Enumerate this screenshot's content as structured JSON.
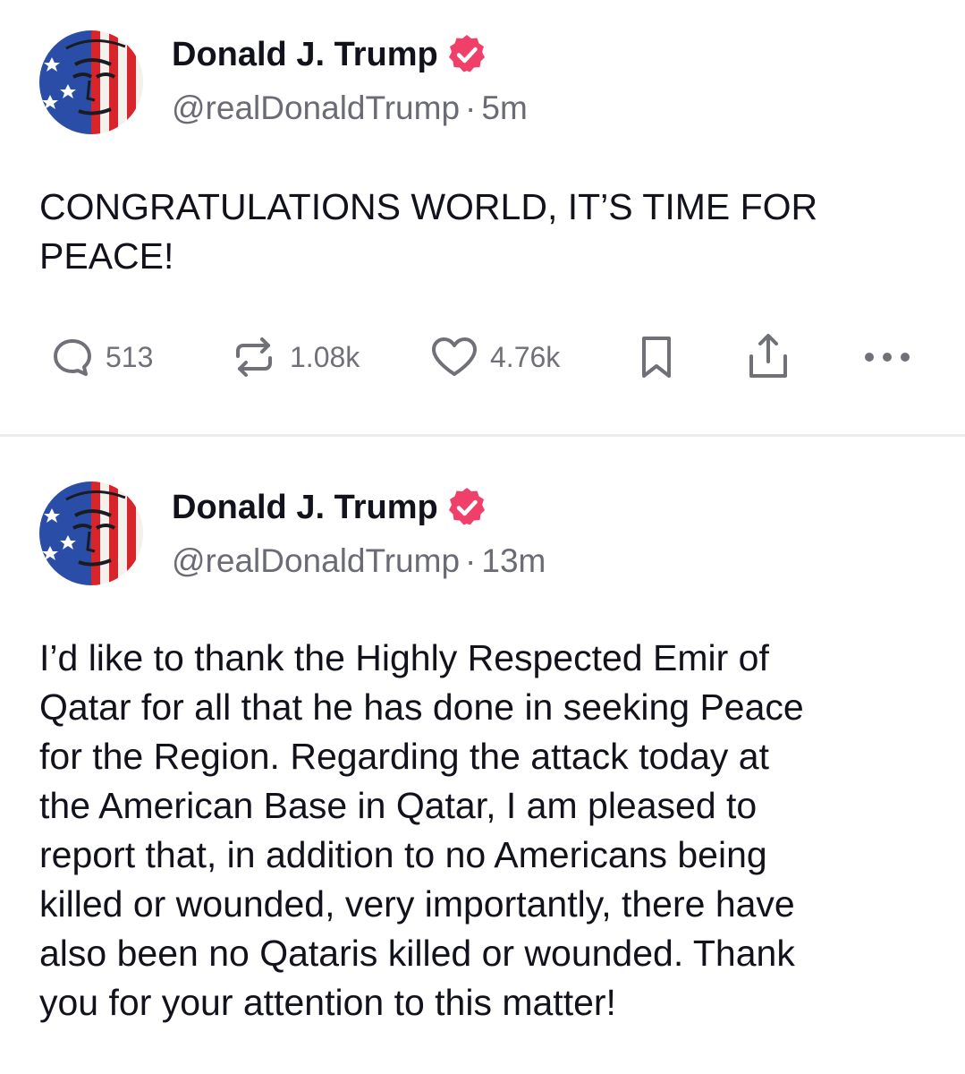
{
  "posts": [
    {
      "author": {
        "display_name": "Donald J. Trump",
        "handle": "@realDonaldTrump",
        "verified": true,
        "avatar_icon": "flag-face-avatar"
      },
      "timestamp": "5m",
      "separator": "·",
      "text": "CONGRATULATIONS WORLD, IT’S TIME FOR\nPEACE!",
      "stats": {
        "replies": "513",
        "reposts": "1.08k",
        "likes": "4.76k"
      }
    },
    {
      "author": {
        "display_name": "Donald J. Trump",
        "handle": "@realDonaldTrump",
        "verified": true,
        "avatar_icon": "flag-face-avatar"
      },
      "timestamp": "13m",
      "separator": "·",
      "text": "I’d like to thank the Highly Respected Emir of\nQatar for all that he has done in seeking Peace\nfor the Region. Regarding the attack today at\nthe American Base in Qatar, I am pleased to\nreport that, in addition to no Americans being\nkilled or wounded, very importantly, there have\nalso been no Qataris killed or wounded. Thank\nyou for your attention to this matter!"
    }
  ],
  "icons": {
    "reply": "reply-icon",
    "repost": "repost-icon",
    "like": "heart-icon",
    "bookmark": "bookmark-icon",
    "share": "share-icon",
    "more": "more-icon",
    "verified": "verified-badge-icon"
  },
  "colors": {
    "verified_badge": "#f0406a",
    "icon_gray": "#707079",
    "text_primary": "#12121c",
    "text_secondary": "#6b6b76"
  }
}
